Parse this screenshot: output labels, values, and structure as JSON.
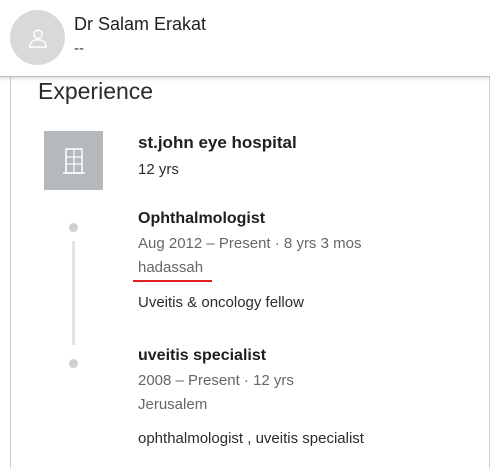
{
  "profile": {
    "name": "Dr Salam Erakat",
    "headline": "--",
    "avatar_icon": "user-silhouette-icon"
  },
  "experience": {
    "section_title": "Experience",
    "company": {
      "name": "st.john eye hospital",
      "tenure": "12 yrs",
      "logo_icon": "building-icon"
    },
    "positions": [
      {
        "title": "Ophthalmologist",
        "dates": "Aug 2012 – Present · 8 yrs 3 mos",
        "location": "hadassah",
        "description": "Uveitis & oncology fellow"
      },
      {
        "title": "uveitis specialist",
        "dates": "2008 – Present · 12 yrs",
        "location": "Jerusalem",
        "description": "ophthalmologist , uveitis specialist"
      }
    ]
  },
  "colors": {
    "avatar_bg": "#d9d9d9",
    "logo_bg": "#b6b9bc",
    "annotation_red": "#e02020"
  }
}
